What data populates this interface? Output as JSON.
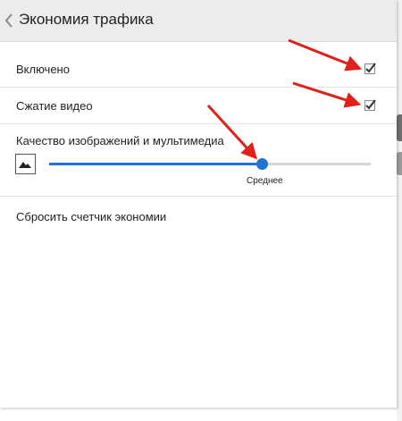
{
  "header": {
    "title": "Экономия трафика"
  },
  "settings": {
    "enabled": {
      "label": "Включено",
      "checked": true
    },
    "video_compression": {
      "label": "Сжатие видео",
      "checked": true
    },
    "image_quality": {
      "label": "Качество изображений и мультимедиа",
      "level": 0.66,
      "value_label": "Среднее"
    },
    "reset": {
      "label": "Сбросить счетчик экономии"
    }
  },
  "colors": {
    "accent": "#1f76d2",
    "annotation_arrow": "#e0201b",
    "header_bg": "#ececec"
  },
  "icons": {
    "back": "chevron-left-icon",
    "image": "image-mountains-icon",
    "check": "checkmark-icon"
  }
}
